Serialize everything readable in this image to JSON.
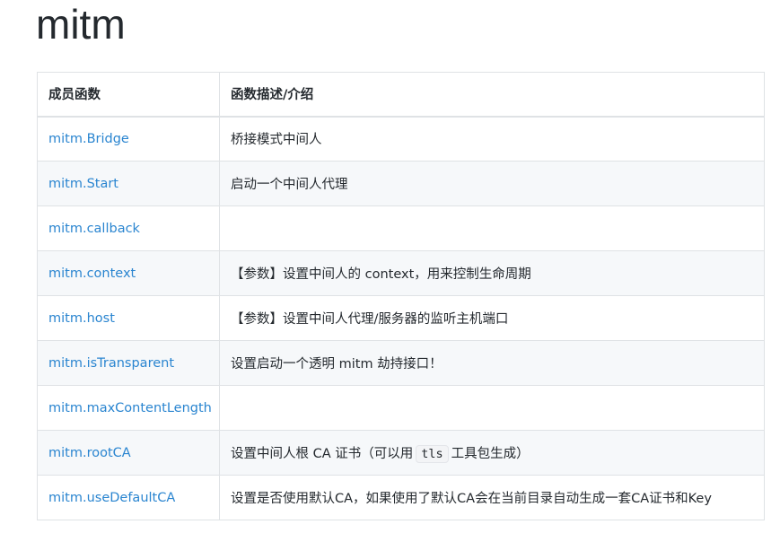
{
  "title": "mitm",
  "table": {
    "headers": [
      "成员函数",
      "函数描述/介绍"
    ],
    "rows": [
      {
        "name": "mitm.Bridge",
        "desc": "桥接模式中间人"
      },
      {
        "name": "mitm.Start",
        "desc": "启动一个中间人代理"
      },
      {
        "name": "mitm.callback",
        "desc": ""
      },
      {
        "name": "mitm.context",
        "desc": "【参数】设置中间人的 context，用来控制生命周期"
      },
      {
        "name": "mitm.host",
        "desc": "【参数】设置中间人代理/服务器的监听主机端口"
      },
      {
        "name": "mitm.isTransparent",
        "desc": "设置启动一个透明 mitm 劫持接口！"
      },
      {
        "name": "mitm.maxContentLength",
        "desc": ""
      },
      {
        "name": "mitm.rootCA",
        "desc_before": "设置中间人根 CA 证书（可以用",
        "desc_code": "tls",
        "desc_after": "工具包生成）"
      },
      {
        "name": "mitm.useDefaultCA",
        "desc": "设置是否使用默认CA，如果使用了默认CA会在当前目录自动生成一套CA证书和Key"
      }
    ]
  },
  "colors": {
    "link": "#2a85d0",
    "border": "#dfe2e5",
    "stripe": "#f6f8fa"
  }
}
